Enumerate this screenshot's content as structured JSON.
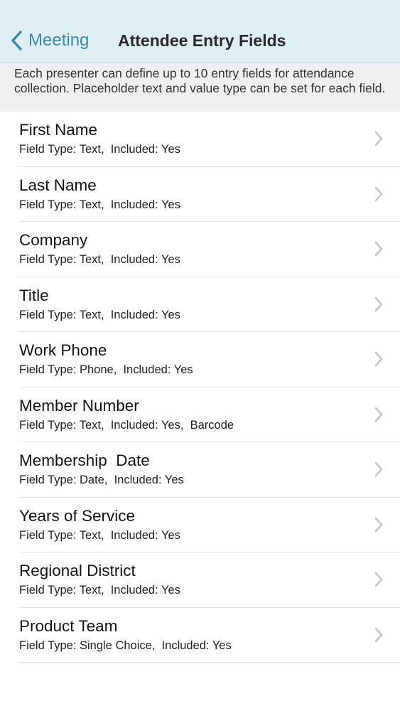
{
  "navbar": {
    "back_label": "Meeting",
    "title": "Attendee Entry Fields",
    "back_icon": "chevron-left-icon",
    "accent_color": "#3a8aa0",
    "background_color": "#dfeef3"
  },
  "description": "Each presenter can define up to 10 entry fields for attendance collection.  Placeholder text and value type can be set for each field.",
  "fields": [
    {
      "name": "First Name",
      "detail": "Field Type: Text,  Included: Yes"
    },
    {
      "name": "Last Name",
      "detail": "Field Type: Text,  Included: Yes"
    },
    {
      "name": "Company",
      "detail": "Field Type: Text,  Included: Yes"
    },
    {
      "name": "Title",
      "detail": "Field Type: Text,  Included: Yes"
    },
    {
      "name": "Work Phone",
      "detail": "Field Type: Phone,  Included: Yes"
    },
    {
      "name": "Member Number",
      "detail": "Field Type: Text,  Included: Yes,  Barcode"
    },
    {
      "name": "Membership  Date",
      "detail": "Field Type: Date,  Included: Yes"
    },
    {
      "name": "Years of Service",
      "detail": "Field Type: Text,  Included: Yes"
    },
    {
      "name": "Regional District",
      "detail": "Field Type: Text,  Included: Yes"
    },
    {
      "name": "Product Team",
      "detail": "Field Type: Single Choice,  Included: Yes"
    }
  ],
  "row_icon": "chevron-right-icon"
}
